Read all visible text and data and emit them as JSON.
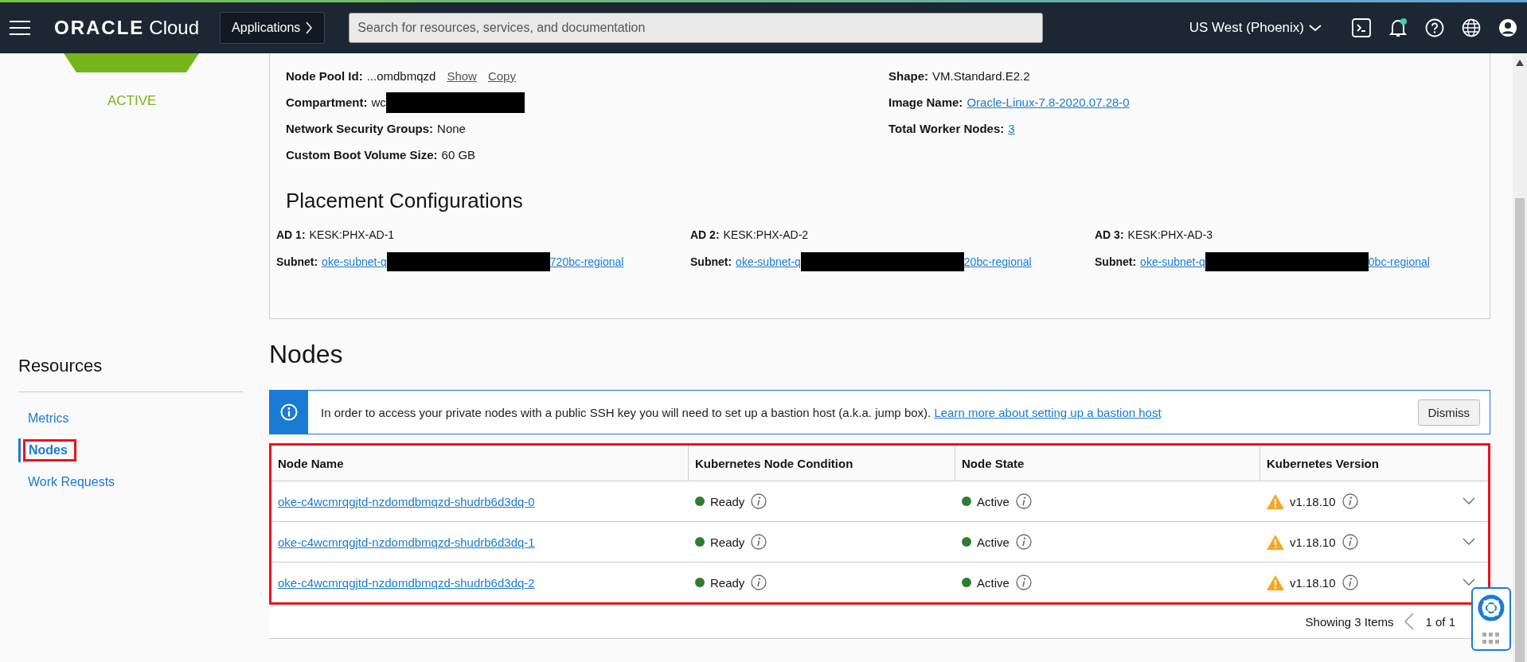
{
  "header": {
    "brand": "ORACLE",
    "product": "Cloud",
    "apps_button": "Applications",
    "search": {
      "placeholder": "Search for resources, services, and documentation"
    },
    "region": "US West (Phoenix)",
    "notifications": {
      "unread": true
    }
  },
  "sidebar": {
    "status": "ACTIVE",
    "resources_title": "Resources",
    "items": [
      {
        "label": "Metrics",
        "selected": false
      },
      {
        "label": "Nodes",
        "selected": true
      },
      {
        "label": "Work Requests",
        "selected": false
      }
    ]
  },
  "details": {
    "left": [
      {
        "kind": "id",
        "label": "Node Pool Id:",
        "value": "...omdbmqzd",
        "actions": [
          "Show",
          "Copy"
        ]
      },
      {
        "kind": "redacted",
        "label": "Compartment:",
        "value": "wc"
      },
      {
        "kind": "text",
        "label": "Network Security Groups:",
        "value": "None"
      },
      {
        "kind": "text",
        "label": "Custom Boot Volume Size:",
        "value": "60 GB"
      }
    ],
    "right": [
      {
        "kind": "text",
        "label": "Shape:",
        "value": "VM.Standard.E2.2"
      },
      {
        "kind": "link",
        "label": "Image Name:",
        "value": "Oracle-Linux-7.8-2020.07.28-0"
      },
      {
        "kind": "link",
        "label": "Total Worker Nodes:",
        "value": "3"
      }
    ]
  },
  "placement": {
    "title": "Placement Configurations",
    "ads": [
      {
        "label": "AD 1:",
        "value": "KESK:PHX-AD-1",
        "subnet_label": "Subnet:",
        "subnet_prefix": "oke-subnet-q",
        "subnet_suffix": "720bc-regional"
      },
      {
        "label": "AD 2:",
        "value": "KESK:PHX-AD-2",
        "subnet_label": "Subnet:",
        "subnet_prefix": "oke-subnet-q",
        "subnet_suffix": "20bc-regional"
      },
      {
        "label": "AD 3:",
        "value": "KESK:PHX-AD-3",
        "subnet_label": "Subnet:",
        "subnet_prefix": "oke-subnet-q",
        "subnet_suffix": "0bc-regional"
      }
    ]
  },
  "nodes": {
    "title": "Nodes",
    "banner": {
      "text": "In order to access your private nodes with a public SSH key you will need to set up a bastion host (a.k.a. jump box).",
      "link": "Learn more about setting up a bastion host",
      "dismiss": "Dismiss"
    },
    "table": {
      "columns": [
        "Node Name",
        "Kubernetes Node Condition",
        "Node State",
        "Kubernetes Version"
      ],
      "rows": [
        {
          "name": "oke-c4wcmrqgjtd-nzdomdbmqzd-shudrb6d3dq-0",
          "condition": "Ready",
          "state": "Active",
          "version": "v1.18.10",
          "expanded": false
        },
        {
          "name": "oke-c4wcmrqgjtd-nzdomdbmqzd-shudrb6d3dq-1",
          "condition": "Ready",
          "state": "Active",
          "version": "v1.18.10",
          "expanded": false
        },
        {
          "name": "oke-c4wcmrqgjtd-nzdomdbmqzd-shudrb6d3dq-2",
          "condition": "Ready",
          "state": "Active",
          "version": "v1.18.10",
          "expanded": false
        }
      ]
    },
    "footer": {
      "showing": "Showing 3 Items",
      "page": "1 of 1"
    }
  }
}
